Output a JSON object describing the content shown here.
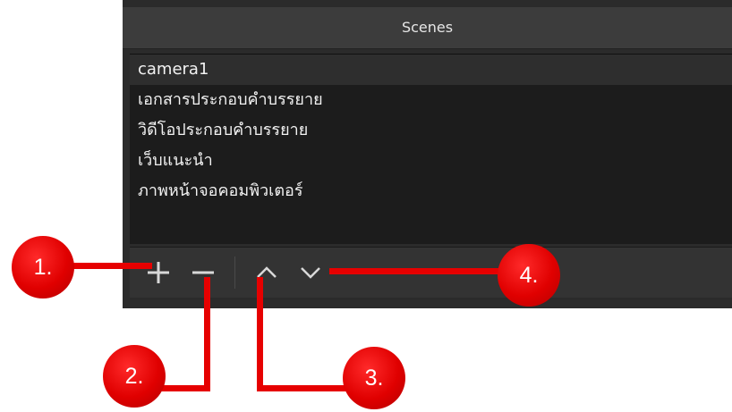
{
  "panel": {
    "title": "Scenes",
    "scenes": [
      {
        "label": "camera1",
        "selected": true
      },
      {
        "label": "เอกสารประกอบคำบรรยาย",
        "selected": false
      },
      {
        "label": "วิดีโอประกอบคำบรรยาย",
        "selected": false
      },
      {
        "label": "เว็บแนะนำ",
        "selected": false
      },
      {
        "label": "ภาพหน้าจอคอมพิวเตอร์",
        "selected": false
      }
    ],
    "toolbar": {
      "add_icon": "plus-icon",
      "remove_icon": "minus-icon",
      "move_up_icon": "chevron-up-icon",
      "move_down_icon": "chevron-down-icon"
    }
  },
  "callouts": {
    "c1": "1.",
    "c2": "2.",
    "c3": "3.",
    "c4": "4."
  },
  "colors": {
    "panel_bg": "#2b2b2b",
    "list_bg": "#1c1c1c",
    "callout_red": "#e60000"
  }
}
